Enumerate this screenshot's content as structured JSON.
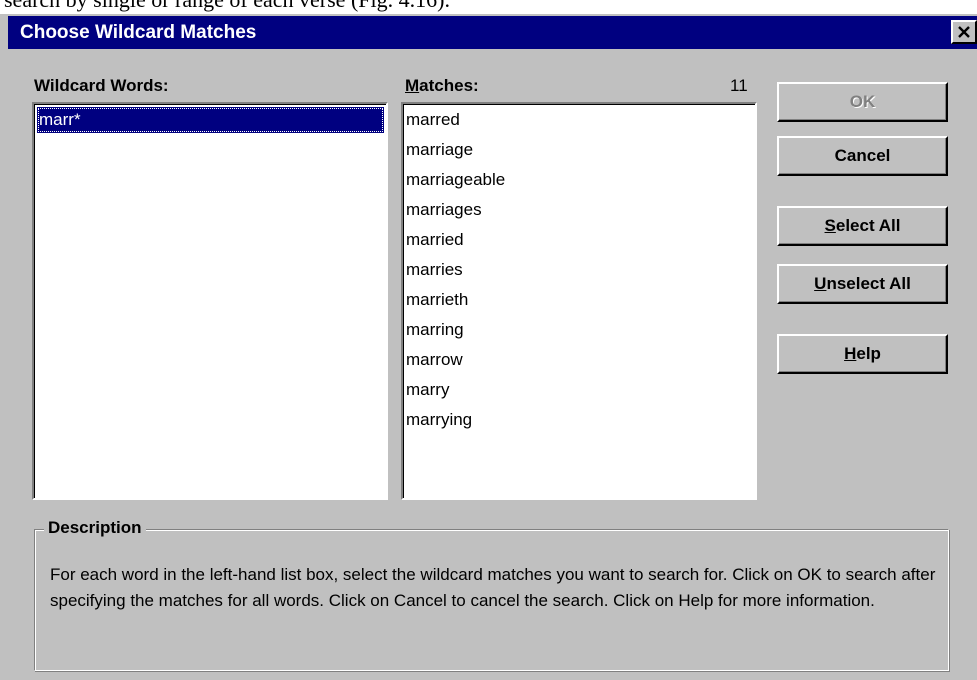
{
  "background_text": "search by single or range of each verse (Fig. 4.16).",
  "window": {
    "title": "Choose Wildcard Matches",
    "close_glyph": "×",
    "colors": {
      "titlebar": "#000080",
      "face": "#c0c0c0",
      "selection": "#000080"
    }
  },
  "wildcard": {
    "label": "Wildcard Words:",
    "items": [
      "marr*"
    ],
    "selected_index": 0
  },
  "matches": {
    "label_accel": "M",
    "label_rest": "atches:",
    "count": "11",
    "items": [
      "marred",
      "marriage",
      "marriageable",
      "marriages",
      "married",
      "marries",
      "marrieth",
      "marring",
      "marrow",
      "marry",
      "marrying"
    ]
  },
  "buttons": {
    "ok": {
      "label": "OK",
      "disabled": true
    },
    "cancel": {
      "label": "Cancel"
    },
    "select_all": {
      "accel": "S",
      "rest": "elect All"
    },
    "unselect_all": {
      "accel": "U",
      "rest": "nselect All"
    },
    "help": {
      "accel": "H",
      "rest": "elp"
    }
  },
  "description": {
    "legend": "Description",
    "text": "For each word in the left-hand list box, select the wildcard matches you want to search for. Click on OK to search after specifying the matches for all words. Click on Cancel to cancel the search. Click on Help for more information."
  }
}
